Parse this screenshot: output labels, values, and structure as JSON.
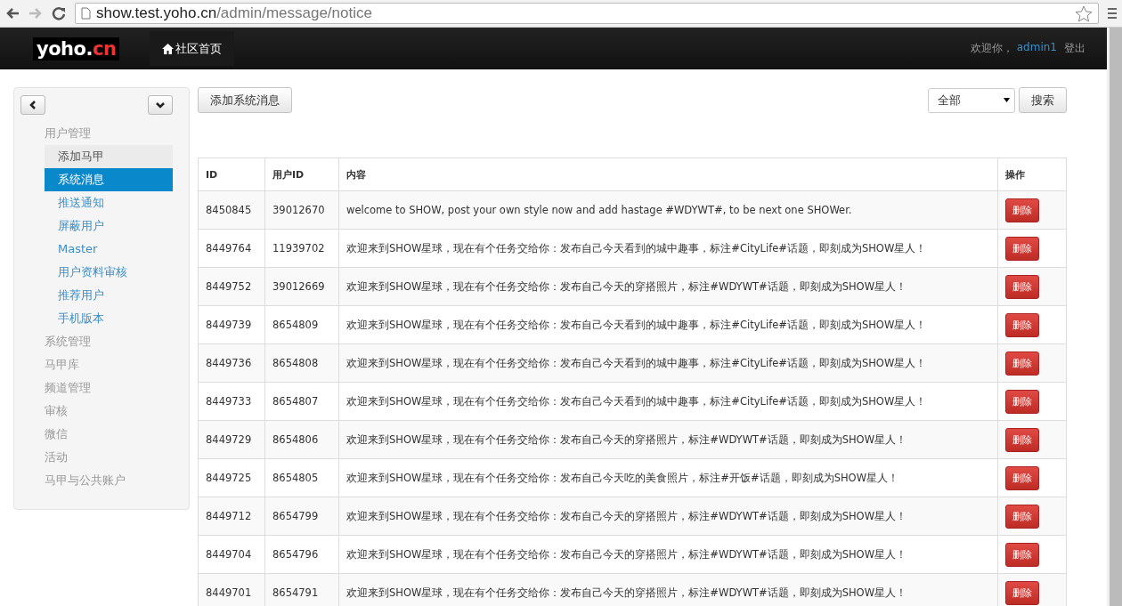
{
  "browser": {
    "url_host": "show.test.yoho.cn",
    "url_path": "/admin/message/notice"
  },
  "navbar": {
    "logo_main": "yoho.",
    "logo_accent": "cn",
    "home_link": "社区首页",
    "welcome": "欢迎你，",
    "user": "admin1",
    "logout": "登出"
  },
  "sidebar": {
    "groups": [
      {
        "label": "用户管理",
        "children": [
          {
            "label": "添加马甲",
            "selected": false,
            "hovered": true
          },
          {
            "label": "系统消息",
            "selected": true,
            "hovered": false
          },
          {
            "label": "推送通知",
            "selected": false,
            "hovered": false
          },
          {
            "label": "屏蔽用户",
            "selected": false,
            "hovered": false
          },
          {
            "label": "Master",
            "selected": false,
            "hovered": false
          },
          {
            "label": "用户资料审核",
            "selected": false,
            "hovered": false
          },
          {
            "label": "推荐用户",
            "selected": false,
            "hovered": false
          },
          {
            "label": "手机版本",
            "selected": false,
            "hovered": false
          }
        ]
      },
      {
        "label": "系统管理"
      },
      {
        "label": "马甲库"
      },
      {
        "label": "频道管理"
      },
      {
        "label": "审核"
      },
      {
        "label": "微信"
      },
      {
        "label": "活动"
      },
      {
        "label": "马甲与公共账户"
      }
    ]
  },
  "toolbar": {
    "add_button": "添加系统消息",
    "filter": {
      "value": "全部"
    },
    "search_button": "搜索"
  },
  "table": {
    "columns": [
      "ID",
      "用户ID",
      "内容",
      "操作"
    ],
    "rows": [
      {
        "id": "8450845",
        "user_id": "39012670",
        "content": "welcome to SHOW, post your own style now and add hastage #WDYWT#, to be next one SHOWer.",
        "action": "删除"
      },
      {
        "id": "8449764",
        "user_id": "11939702",
        "content": "欢迎来到SHOW星球，现在有个任务交给你：发布自己今天看到的城中趣事，标注#CityLife#话题，即刻成为SHOW星人！",
        "action": "删除"
      },
      {
        "id": "8449752",
        "user_id": "39012669",
        "content": "欢迎来到SHOW星球，现在有个任务交给你：发布自己今天的穿搭照片，标注#WDYWT#话题，即刻成为SHOW星人！",
        "action": "删除"
      },
      {
        "id": "8449739",
        "user_id": "8654809",
        "content": "欢迎来到SHOW星球，现在有个任务交给你：发布自己今天看到的城中趣事，标注#CityLife#话题，即刻成为SHOW星人！",
        "action": "删除"
      },
      {
        "id": "8449736",
        "user_id": "8654808",
        "content": "欢迎来到SHOW星球，现在有个任务交给你：发布自己今天看到的城中趣事，标注#CityLife#话题，即刻成为SHOW星人！",
        "action": "删除"
      },
      {
        "id": "8449733",
        "user_id": "8654807",
        "content": "欢迎来到SHOW星球，现在有个任务交给你：发布自己今天看到的城中趣事，标注#CityLife#话题，即刻成为SHOW星人！",
        "action": "删除"
      },
      {
        "id": "8449729",
        "user_id": "8654806",
        "content": "欢迎来到SHOW星球，现在有个任务交给你：发布自己今天的穿搭照片，标注#WDYWT#话题，即刻成为SHOW星人！",
        "action": "删除"
      },
      {
        "id": "8449725",
        "user_id": "8654805",
        "content": "欢迎来到SHOW星球，现在有个任务交给你：发布自己今天吃的美食照片，标注#开饭#话题，即刻成为SHOW星人！",
        "action": "删除"
      },
      {
        "id": "8449712",
        "user_id": "8654799",
        "content": "欢迎来到SHOW星球，现在有个任务交给你：发布自己今天的穿搭照片，标注#WDYWT#话题，即刻成为SHOW星人！",
        "action": "删除"
      },
      {
        "id": "8449704",
        "user_id": "8654796",
        "content": "欢迎来到SHOW星球，现在有个任务交给你：发布自己今天的穿搭照片，标注#WDYWT#话题，即刻成为SHOW星人！",
        "action": "删除"
      },
      {
        "id": "8449701",
        "user_id": "8654791",
        "content": "欢迎来到SHOW星球，现在有个任务交给你：发布自己今天的穿搭照片，标注#WDYWT#话题，即刻成为SHOW星人！",
        "action": "删除"
      }
    ]
  }
}
